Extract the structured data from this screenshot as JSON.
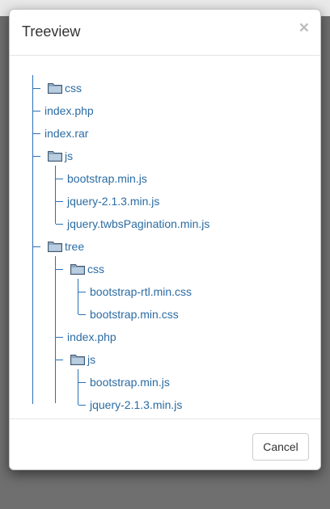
{
  "modal": {
    "title": "Treeview",
    "close_symbol": "×",
    "cancel_label": "Cancel"
  },
  "tree": {
    "css": "css",
    "index_php": "index.php",
    "index_rar": "index.rar",
    "js": "js",
    "js_children": [
      "bootstrap.min.js",
      "jquery-2.1.3.min.js",
      "jquery.twbsPagination.min.js"
    ],
    "tree": "tree",
    "tree_css": "css",
    "tree_css_children": [
      "bootstrap-rtl.min.css",
      "bootstrap.min.css"
    ],
    "tree_index_php": "index.php",
    "tree_js": "js",
    "tree_js_children": [
      "bootstrap.min.js",
      "jquery-2.1.3.min.js"
    ]
  },
  "icons": {
    "folder": "folder-icon",
    "close": "close-icon"
  },
  "colors": {
    "link": "#2b6ca3",
    "tree_line": "#2a71b8",
    "backdrop": "#6f6f6f"
  }
}
